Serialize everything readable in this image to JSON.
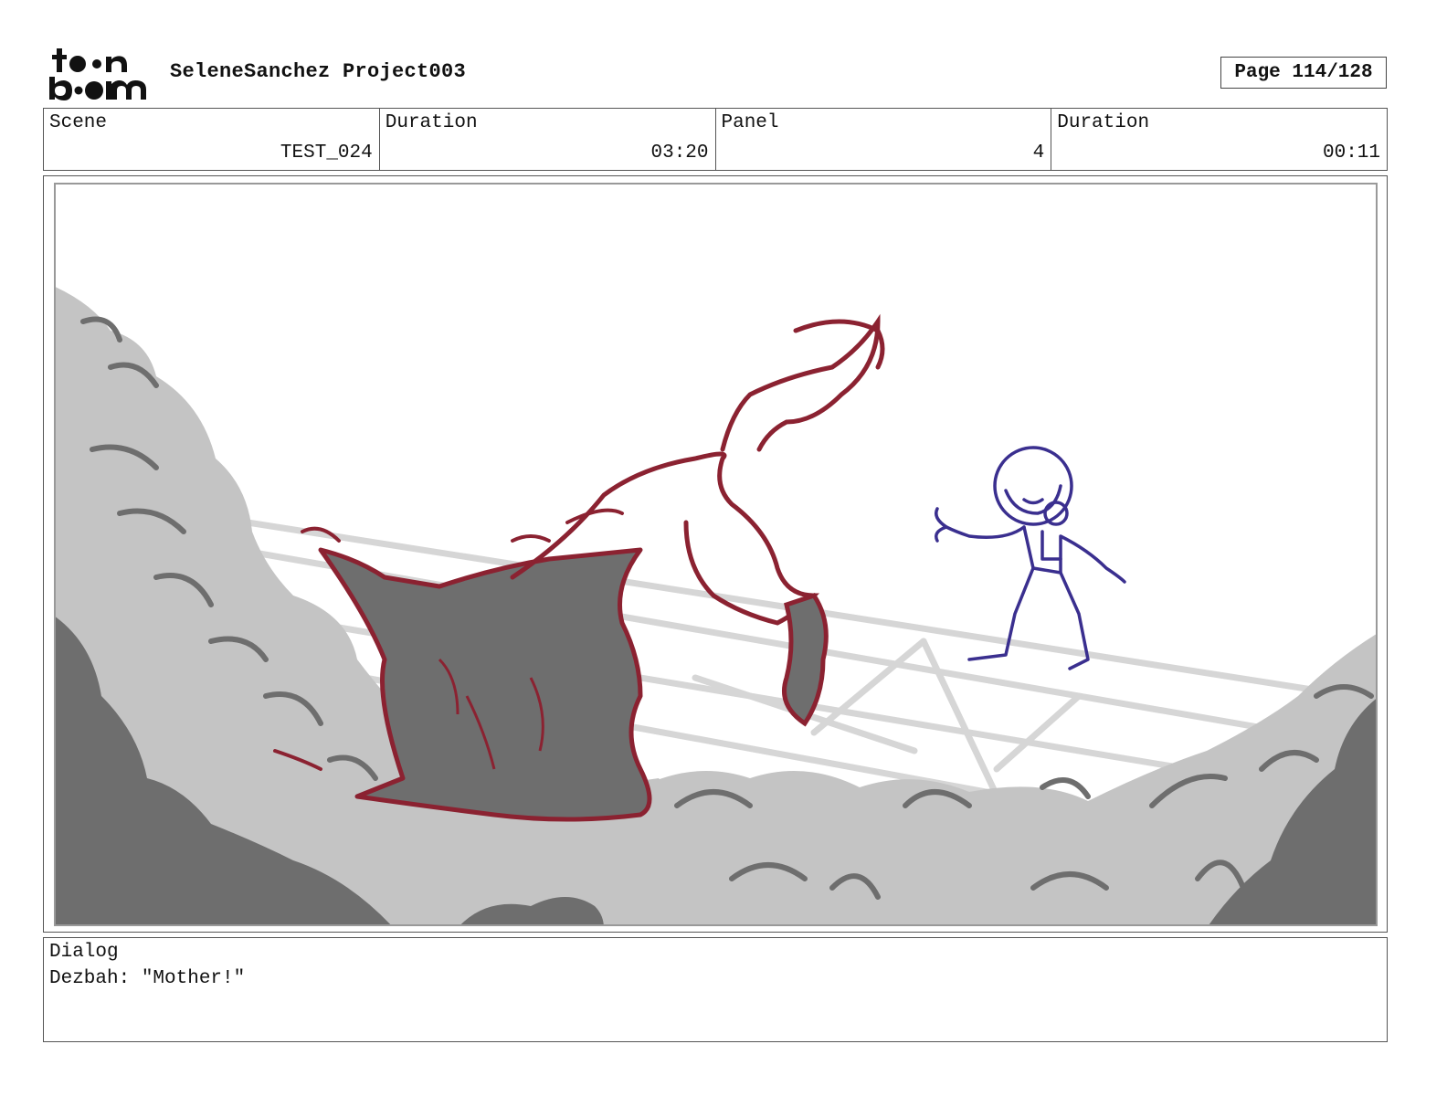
{
  "header": {
    "logo_text": "toon boom",
    "project_title": "SeleneSanchez Project003",
    "page_indicator": "Page 114/128"
  },
  "info": {
    "scene_label": "Scene",
    "scene_value": "TEST_024",
    "scene_duration_label": "Duration",
    "scene_duration_value": "03:20",
    "panel_label": "Panel",
    "panel_value": "4",
    "panel_duration_label": "Duration",
    "panel_duration_value": "00:11"
  },
  "dialog": {
    "label": "Dialog",
    "text": "Dezbah: \"Mother!\""
  },
  "colors": {
    "creature_outline": "#8b2231",
    "character_outline": "#3a2f8f",
    "foliage_light": "#c4c4c4",
    "foliage_dark": "#6e6e6e"
  }
}
